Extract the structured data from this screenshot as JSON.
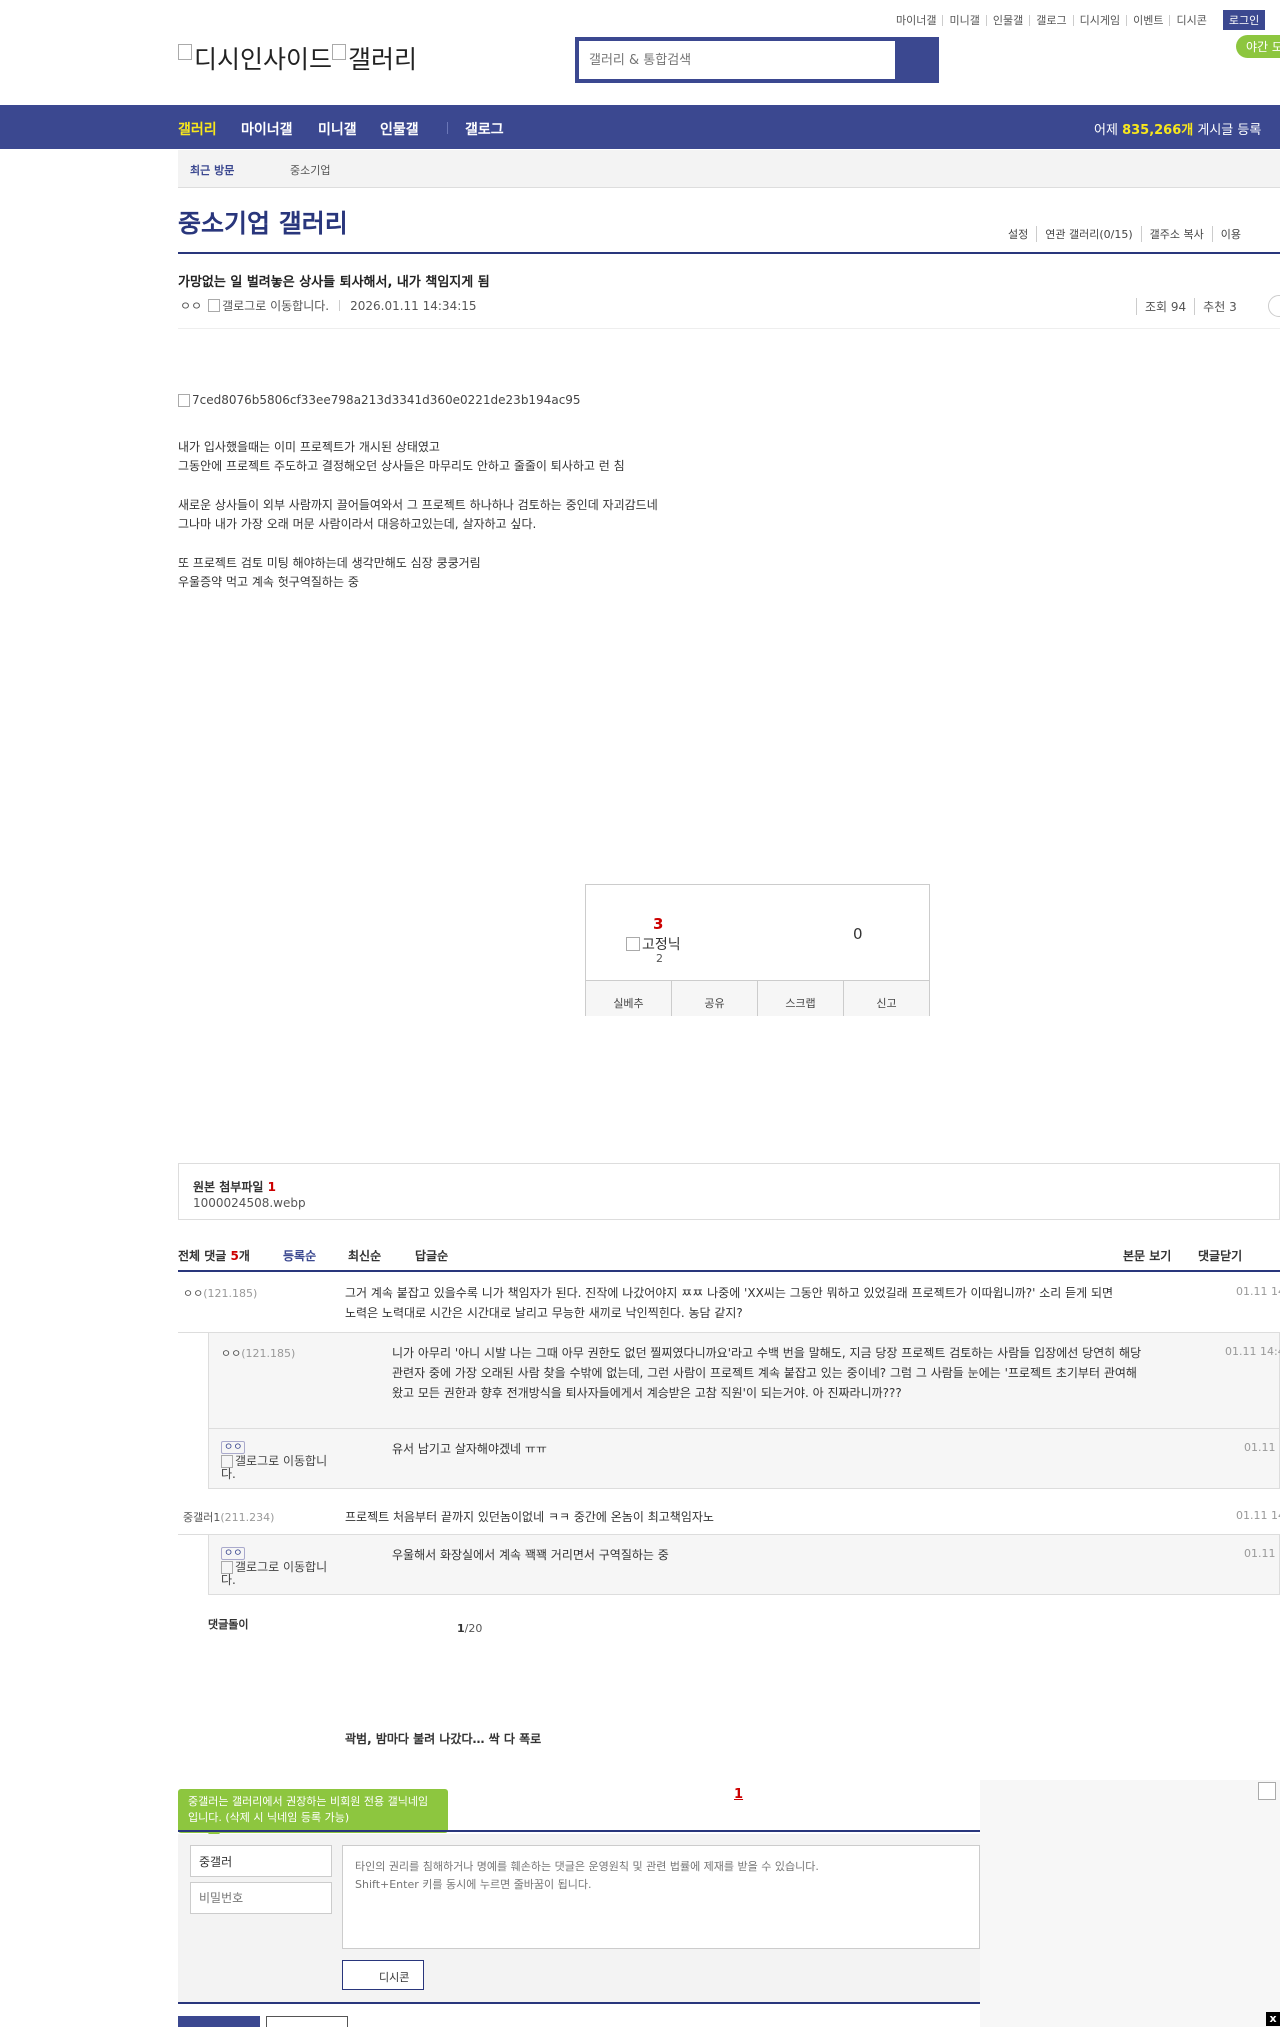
{
  "util": {
    "items": [
      "마이너갤",
      "미니갤",
      "인물갤",
      "갤로그",
      "디시게임",
      "이벤트",
      "디시콘"
    ],
    "login": "로그인",
    "night": "야간 모드"
  },
  "logo": {
    "text1": "디시인사이드",
    "text2": "갤러리"
  },
  "search": {
    "placeholder": "갤러리 & 통합검색"
  },
  "gnb": {
    "items": [
      "갤러리",
      "마이너갤",
      "미니갤",
      "인물갤",
      "갤로그"
    ],
    "count_prefix": "어제 ",
    "count_value": "835,266개",
    "count_suffix": " 게시글 등록"
  },
  "recent": {
    "label": "최근 방문",
    "item": "중소기업"
  },
  "gallery": {
    "title": "중소기업 갤러리",
    "links": [
      "설정",
      "연관 갤러리(0/15)",
      "갤주소 복사",
      "이용"
    ]
  },
  "post": {
    "title": "가망없는 일 벌려놓은 상사들 퇴사해서, 내가 책임지게 됨",
    "author": "ㅇㅇ",
    "author_img_alt": "갤로그로 이동합니다.",
    "datetime": "2026.01.11 14:34:15",
    "views": "조회 94",
    "recommends": "추천 3",
    "image_alt": "7ced8076b5806cf33ee798a213d3341d360e0221de23b194ac95",
    "lines": [
      "내가 입사했을때는 이미 프로젝트가 개시된 상태였고",
      "그동안에 프로젝트 주도하고 결정해오던 상사들은 마무리도 안하고 줄줄이 퇴사하고 런 침",
      "새로운 상사들이 외부 사람까지 끌어들여와서 그 프로젝트 하나하나 검토하는 중인데 자괴감드네",
      "그나마 내가 가장 오래 머문 사람이라서 대응하고있는데, 살자하고 싶다.",
      "또 프로젝트 검토 미팅 해야하는데 생각만해도 심장 쿵쿵거림",
      "우울증약 먹고 계속 헛구역질하는 중"
    ]
  },
  "recommend": {
    "up": "3",
    "fixed_alt": "고정닉",
    "fixed_count": "2",
    "down": "0",
    "buttons": [
      "실베추",
      "공유",
      "스크랩",
      "신고"
    ]
  },
  "attach": {
    "label": "원본 첨부파일 ",
    "count": "1",
    "file": "1000024508.webp"
  },
  "comments_header": {
    "total_prefix": "전체 댓글 ",
    "total_count": "5",
    "total_suffix": "개",
    "sorts": [
      "등록순",
      "최신순",
      "답글순"
    ],
    "view_body": "본문 보기",
    "close": "댓글닫기"
  },
  "comments": [
    {
      "nick": "ㅇㅇ",
      "ip": "(121.185)",
      "text": "그거 계속 붙잡고 있을수록 니가 책임자가 된다. 진작에 나갔어야지 ㅉㅉ 나중에 'XX씨는 그동안 뭐하고 있었길래 프로젝트가 이따윕니까?' 소리 듣게 되면 노력은 노력대로 시간은 시간대로 날리고 무능한 새끼로 낙인찍힌다. 농담 같지?",
      "date": "01.11 14:"
    },
    {
      "nick": "ㅇㅇ",
      "ip": "(121.185)",
      "text": "니가 아무리 '아니 시발 나는 그때 아무 권한도 없던 찔찌였다니까요'라고 수백 번을 말해도, 지금 당장 프로젝트 검토하는 사람들 입장에선 당연히 해당 관련자 중에 가장 오래된 사람 찾을 수밖에 없는데, 그런 사람이 프로젝트 계속 붙잡고 있는 중이네? 그럼 그 사람들 눈에는 '프로젝트 초기부터 관여해왔고 모든 권한과 향후 전개방식을 퇴사자들에게서 계승받은 고참 직원'이 되는거야. 아 진짜라니까???",
      "date": "01.11 14:4"
    },
    {
      "badge": "ㅇㅇ",
      "img_alt": "갤로그로 이동합니다.",
      "text": "유서 남기고 살자해야겠네 ㅠㅠ",
      "date": "01.11 1"
    },
    {
      "nick": "중갤러1",
      "ip": "(211.234)",
      "text": "프로젝트 처음부터 끝까지 있던놈이없네 ㅋㅋ 중간에 온놈이 최고책임자노",
      "date": "01.11 14"
    },
    {
      "badge": "ㅇㅇ",
      "img_alt": "갤로그로 이동합니다.",
      "text": "우울해서 화장실에서 계속 꽥꽥 거리면서 구역질하는 중",
      "date": "01.11 1"
    }
  ],
  "dolly": {
    "label": "댓글돌이",
    "current": "1",
    "total": "/20"
  },
  "ad": {
    "text": "곽범, 밤마다 불려 나갔다… 싹 다 폭로"
  },
  "write": {
    "tip": "중갤러는 갤러리에서 권장하는 비회원 전용 갤닉네임입니다. (삭제 시 닉네임 등록 가능)",
    "page": "1",
    "nick_value": "중갤러",
    "pw_placeholder": "비밀번호",
    "textarea_placeholder": "타인의 권리를 침해하거나 명예를 훼손하는 댓글은 운영원칙 및 관련 법률에 제재를 받을 수 있습니다.\nShift+Enter 키를 동시에 누르면 줄바꿈이 됩니다.",
    "dccon": "디시콘"
  },
  "ad_close": "x"
}
